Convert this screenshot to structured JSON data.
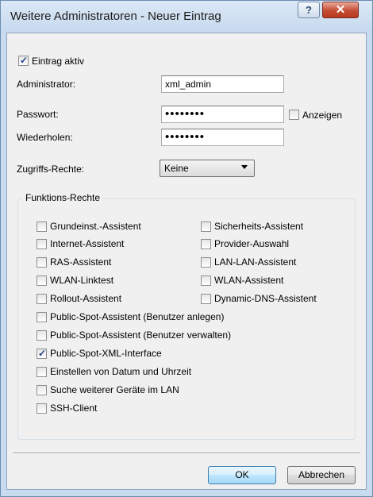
{
  "dialog": {
    "title": "Weitere Administratoren - Neuer Eintrag",
    "help_symbol": "?",
    "close_symbol": "✕"
  },
  "entry_active": {
    "label": "Eintrag aktiv",
    "checked": true
  },
  "administrator": {
    "label": "Administrator:",
    "value": "xml_admin"
  },
  "password": {
    "label": "Passwort:",
    "masked": "••••••••",
    "show_label": "Anzeigen",
    "show_checked": false
  },
  "repeat": {
    "label": "Wiederholen:",
    "masked": "••••••••"
  },
  "access_rights": {
    "label": "Zugriffs-Rechte:",
    "selected": "Keine"
  },
  "function_rights": {
    "legend": "Funktions-Rechte",
    "items": [
      {
        "label": "Grundeinst.-Assistent",
        "checked": false
      },
      {
        "label": "Sicherheits-Assistent",
        "checked": false
      },
      {
        "label": "Internet-Assistent",
        "checked": false
      },
      {
        "label": "Provider-Auswahl",
        "checked": false
      },
      {
        "label": "RAS-Assistent",
        "checked": false
      },
      {
        "label": "LAN-LAN-Assistent",
        "checked": false
      },
      {
        "label": "WLAN-Linktest",
        "checked": false
      },
      {
        "label": "WLAN-Assistent",
        "checked": false
      },
      {
        "label": "Rollout-Assistent",
        "checked": false
      },
      {
        "label": "Dynamic-DNS-Assistent",
        "checked": false
      },
      {
        "label": "Public-Spot-Assistent (Benutzer anlegen)",
        "checked": false
      },
      {
        "label": "Public-Spot-Assistent (Benutzer verwalten)",
        "checked": false
      },
      {
        "label": "Public-Spot-XML-Interface",
        "checked": true
      },
      {
        "label": "Einstellen von Datum und Uhrzeit",
        "checked": false
      },
      {
        "label": "Suche weiterer Geräte im LAN",
        "checked": false
      },
      {
        "label": "SSH-Client",
        "checked": false
      }
    ]
  },
  "buttons": {
    "ok": "OK",
    "cancel": "Abbrechen"
  }
}
